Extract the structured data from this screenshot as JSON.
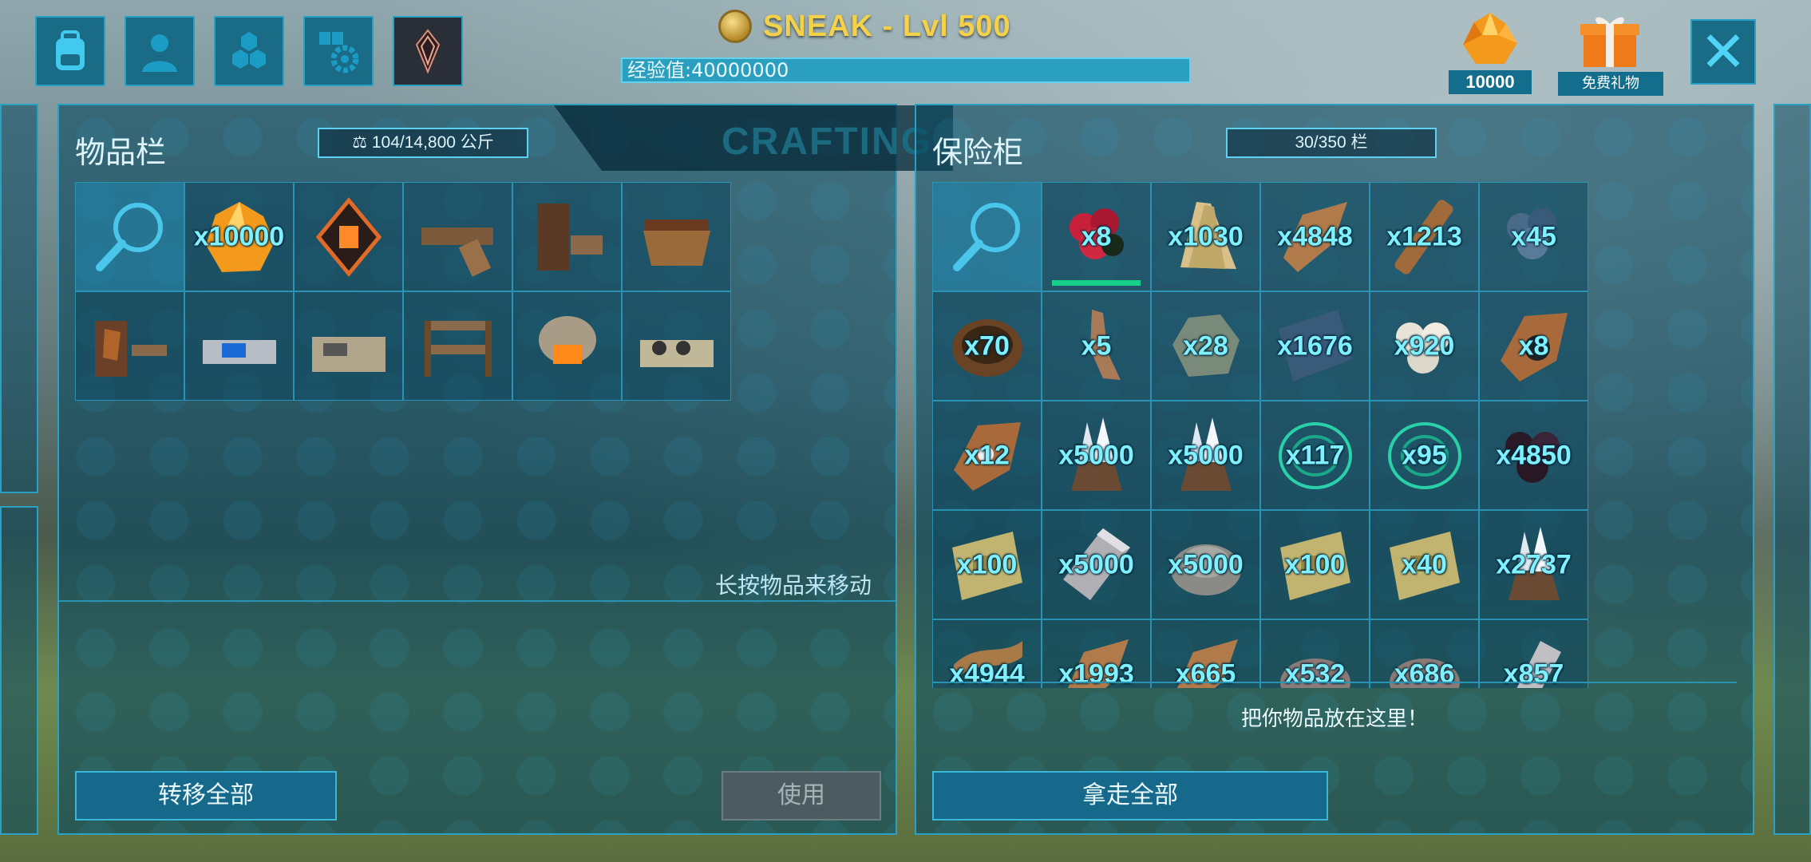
{
  "top_bar": {
    "player_title": "SNEAK - Lvl 500",
    "xp_label": "经验值:40000000",
    "currency_value": "10000",
    "gift_label": "免费礼物",
    "nav_icons": [
      "backpack-icon",
      "character-icon",
      "engrams-icon",
      "settings-icon",
      "tribe-crystal-icon"
    ]
  },
  "inventory": {
    "title": "物品栏",
    "weight": "104/14,800 公斤",
    "crafting_tab": "CRAFTING",
    "hint": "长按物品来移动",
    "transfer_all": "转移全部",
    "use": "使用",
    "items": [
      {
        "qty": "",
        "icon": "search"
      },
      {
        "qty": "x10000",
        "icon": "element"
      },
      {
        "qty": "",
        "icon": "tek-implant"
      },
      {
        "qty": "",
        "icon": "smithy"
      },
      {
        "qty": "",
        "icon": "bookshelf"
      },
      {
        "qty": "",
        "icon": "fabricator"
      },
      {
        "qty": "",
        "icon": "tanning-rack"
      },
      {
        "qty": "",
        "icon": "chemistry-bench"
      },
      {
        "qty": "",
        "icon": "cooking-station"
      },
      {
        "qty": "",
        "icon": "shelf"
      },
      {
        "qty": "",
        "icon": "forge"
      },
      {
        "qty": "",
        "icon": "industrial-cooker"
      }
    ]
  },
  "vault": {
    "title": "保险柜",
    "slots": "30/350 栏",
    "drop_hint": "把你物品放在这里！",
    "take_all": "拿走全部",
    "items": [
      {
        "qty": "",
        "icon": "search"
      },
      {
        "qty": "x8",
        "icon": "berries-red"
      },
      {
        "qty": "x1030",
        "icon": "thatch"
      },
      {
        "qty": "x4848",
        "icon": "hide"
      },
      {
        "qty": "x1213",
        "icon": "wood"
      },
      {
        "qty": "x45",
        "icon": "berries-blue"
      },
      {
        "qty": "x70",
        "icon": "bowl"
      },
      {
        "qty": "x5",
        "icon": "tooth"
      },
      {
        "qty": "x28",
        "icon": "metal-ore"
      },
      {
        "qty": "x1676",
        "icon": "cloth"
      },
      {
        "qty": "x920",
        "icon": "pearls"
      },
      {
        "qty": "x8",
        "icon": "obsidian-hide"
      },
      {
        "qty": "x12",
        "icon": "pearl-hide"
      },
      {
        "qty": "x5000",
        "icon": "crystal"
      },
      {
        "qty": "x5000",
        "icon": "crystal"
      },
      {
        "qty": "x117",
        "icon": "fiber-green"
      },
      {
        "qty": "x95",
        "icon": "fiber-green"
      },
      {
        "qty": "x4850",
        "icon": "black-pearls"
      },
      {
        "qty": "x100",
        "icon": "circuit"
      },
      {
        "qty": "x5000",
        "icon": "metal-ingot"
      },
      {
        "qty": "x5000",
        "icon": "cementing-paste"
      },
      {
        "qty": "x100",
        "icon": "circuit"
      },
      {
        "qty": "x40",
        "icon": "circuit"
      },
      {
        "qty": "x2737",
        "icon": "crystal"
      },
      {
        "qty": "x4944",
        "icon": "fiber"
      },
      {
        "qty": "x1993",
        "icon": "hide"
      },
      {
        "qty": "x665",
        "icon": "hide"
      },
      {
        "qty": "x532",
        "icon": "stone"
      },
      {
        "qty": "x686",
        "icon": "stone"
      },
      {
        "qty": "x857",
        "icon": "ingot"
      }
    ]
  },
  "colors": {
    "accent": "#2aa0c2",
    "qty_text": "#7ff0ff",
    "title_gold": "#f3d24a",
    "panel_bg": "#0a4860"
  }
}
